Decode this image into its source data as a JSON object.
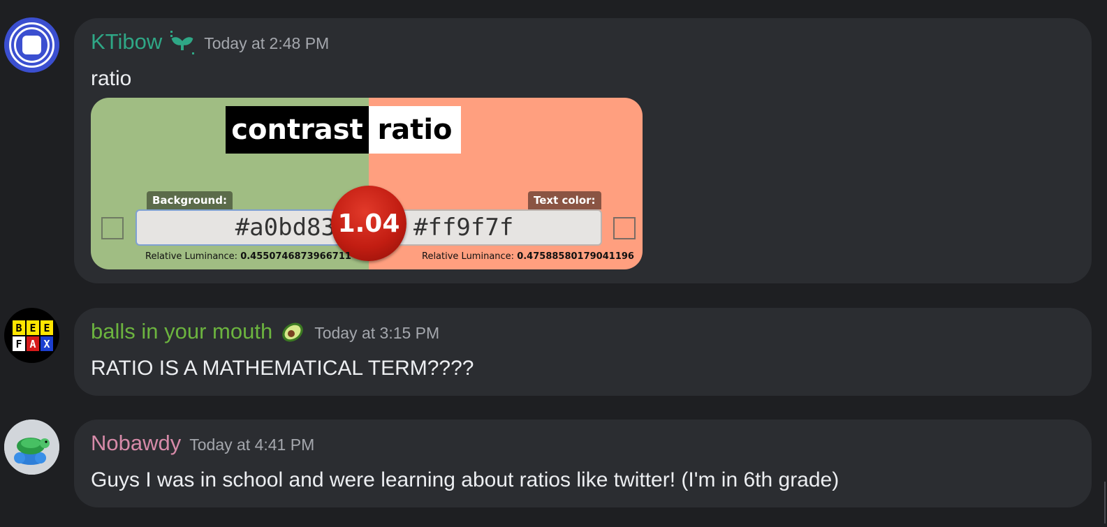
{
  "messages": [
    {
      "username": "KTibow",
      "timestamp": "Today at 2:48 PM",
      "text": "ratio",
      "username_color": "#2fa786",
      "badge_icon": "sprout-icon",
      "embed": {
        "title_left": "contrast",
        "title_right": "ratio",
        "background_label": "Background:",
        "text_color_label": "Text color:",
        "background_value": "#a0bd83",
        "text_color_value": "#ff9f7f",
        "ratio": "1.04",
        "lum_label": "Relative Luminance:",
        "background_luminance": "0.4550746873966711",
        "text_luminance": "0.47588580179041196"
      }
    },
    {
      "username": "balls in your mouth",
      "timestamp": "Today at 3:15 PM",
      "text": "RATIO IS A MATHEMATICAL TERM????",
      "username_color": "#6cb43f",
      "badge_icon": "avocado-icon",
      "avatar_letters": [
        "B",
        "E",
        "E",
        "F",
        "A",
        "X"
      ]
    },
    {
      "username": "Nobawdy",
      "timestamp": "Today at 4:41 PM",
      "text": "Guys I was in school and were learning about ratios like twitter! (I'm in 6th grade)",
      "username_color": "#d68aa8",
      "avatar_icon": "turtle-icon"
    }
  ]
}
